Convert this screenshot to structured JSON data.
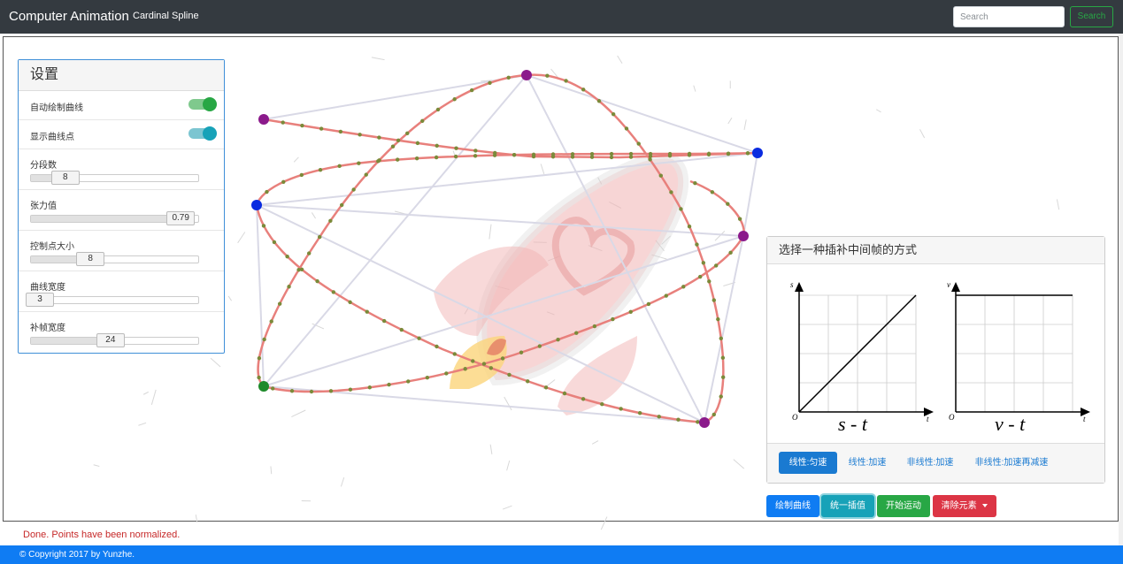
{
  "navbar": {
    "brand": "Computer Animation",
    "link": "Cardinal Spline",
    "search_placeholder": "Search",
    "search_button": "Search"
  },
  "settings": {
    "title": "设置",
    "auto_draw_label": "自动绘制曲线",
    "auto_draw_on": true,
    "show_points_label": "显示曲线点",
    "show_points_on": true,
    "segments_label": "分段数",
    "segments_value": "8",
    "segments_fraction": 0.2,
    "tension_label": "张力值",
    "tension_value": "0.79",
    "tension_fraction": 0.89,
    "control_size_label": "控制点大小",
    "control_size_value": "8",
    "control_size_fraction": 0.35,
    "line_width_label": "曲线宽度",
    "line_width_value": "3",
    "line_width_fraction": 0.0,
    "frame_width_label": "补帧宽度",
    "frame_width_value": "24",
    "frame_width_fraction": 0.47
  },
  "interp_panel": {
    "title": "选择一种插补中间帧的方式",
    "chart1_label": "s - t",
    "chart2_label": "v - t",
    "axis_s": "s",
    "axis_v": "v",
    "axis_t": "t",
    "origin": "O",
    "tick_one": "1",
    "options": [
      {
        "label": "线性:匀速",
        "active": true
      },
      {
        "label": "线性:加速",
        "active": false
      },
      {
        "label": "非线性:加速",
        "active": false
      },
      {
        "label": "非线性:加速再减速",
        "active": false
      }
    ]
  },
  "actions": {
    "draw_curve": "绘制曲线",
    "unify_interp": "统一插值",
    "start_motion": "开始运动",
    "clear_elements": "清除元素"
  },
  "status": "Done. Points have been normalized.",
  "footer": "© Copyright 2017 by Yunzhe.",
  "colors": {
    "curve": "#e8807c",
    "curve_point": "#7b8a3a",
    "control_purple": "#8b1a8b",
    "control_blue": "#0a2be0",
    "control_green": "#1e8a2a",
    "primary": "#0f7cf3",
    "info": "#17a2b8",
    "success": "#28a745",
    "danger": "#dc3545",
    "navbar": "#343a40"
  }
}
